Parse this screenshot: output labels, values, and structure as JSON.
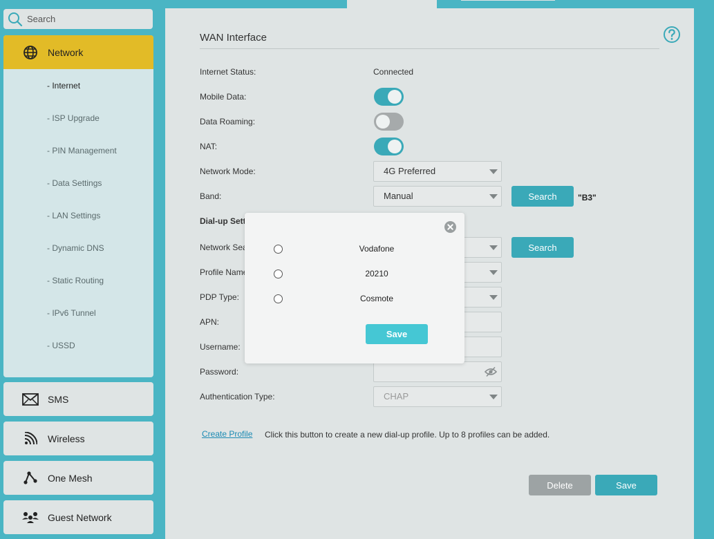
{
  "sidebar": {
    "search_placeholder": "Search",
    "network": {
      "label": "Network",
      "items": [
        {
          "label": "- Internet"
        },
        {
          "label": "- ISP Upgrade"
        },
        {
          "label": "- PIN Management"
        },
        {
          "label": "- Data Settings"
        },
        {
          "label": "- LAN Settings"
        },
        {
          "label": "- Dynamic DNS"
        },
        {
          "label": "- Static Routing"
        },
        {
          "label": "- IPv6 Tunnel"
        },
        {
          "label": "- USSD"
        }
      ]
    },
    "sms": {
      "label": "SMS"
    },
    "wireless": {
      "label": "Wireless"
    },
    "one_mesh": {
      "label": "One Mesh"
    },
    "guest_network": {
      "label": "Guest Network"
    }
  },
  "main": {
    "title": "WAN Interface",
    "internet_status": {
      "label": "Internet Status:",
      "value": "Connected"
    },
    "mobile_data": {
      "label": "Mobile Data:",
      "on": true
    },
    "data_roaming": {
      "label": "Data Roaming:",
      "on": false
    },
    "nat": {
      "label": "NAT:",
      "on": true
    },
    "network_mode": {
      "label": "Network Mode:",
      "value": "4G Preferred"
    },
    "band": {
      "label": "Band:",
      "value": "Manual",
      "search_label": "Search",
      "selected": "\"B3\""
    },
    "dialup_heading": "Dial-up Sett",
    "network_search": {
      "label": "Network Sea",
      "search_label": "Search"
    },
    "profile_name": {
      "label": "Profile Name"
    },
    "pdp_type": {
      "label": "PDP Type:"
    },
    "apn": {
      "label": "APN:"
    },
    "username": {
      "label": "Username:"
    },
    "password": {
      "label": "Password:"
    },
    "auth_type": {
      "label": "Authentication Type:",
      "value": "CHAP"
    },
    "create_profile": {
      "link": "Create Profile",
      "description": "Click this button to create a new dial-up profile. Up to 8 profiles can be added."
    },
    "buttons": {
      "delete": "Delete",
      "save": "Save"
    }
  },
  "modal": {
    "options": [
      {
        "label": "Vodafone"
      },
      {
        "label": "20210"
      },
      {
        "label": "Cosmote"
      }
    ],
    "save_label": "Save"
  },
  "colors": {
    "accent": "#3aa9b8",
    "active_nav": "#e2bb27",
    "background": "#4ab5c4"
  }
}
